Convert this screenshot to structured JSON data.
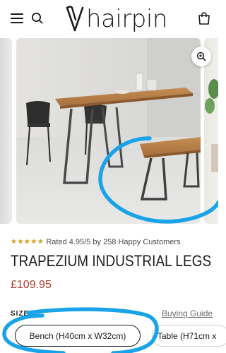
{
  "header": {
    "logo_text": "hairpin",
    "menu_icon": "hamburger-menu-icon",
    "search_icon": "search-icon",
    "cart_icon": "shopping-bag-icon"
  },
  "gallery": {
    "zoom_icon": "zoom-in-icon"
  },
  "product": {
    "stars": [
      "★",
      "★",
      "★",
      "★",
      "★"
    ],
    "rating_text": "Rated 4.95/5 by 258 Happy Customers",
    "title": "TRAPEZIUM INDUSTRIAL LEGS",
    "price": "£109.95"
  },
  "size": {
    "label": "SIZE",
    "guide_label": "Buying Guide",
    "options": [
      {
        "label": "Bench (H40cm x W32cm)",
        "selected": true
      },
      {
        "label": "Table (H71cm x",
        "selected": false
      }
    ]
  },
  "colors": {
    "accent_price": "#b33a2c",
    "star": "#d89a1a",
    "annotation": "#1aa3e8"
  }
}
